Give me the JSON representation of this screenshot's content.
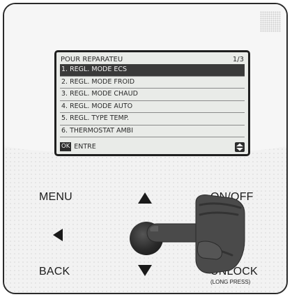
{
  "lcd": {
    "title": "POUR REPARATEU",
    "page": "1/3",
    "items": [
      {
        "label": "1. REGL. MODE ECS",
        "selected": true
      },
      {
        "label": "2. REGL. MODE FROID",
        "selected": false
      },
      {
        "label": "3. REGL. MODE CHAUD",
        "selected": false
      },
      {
        "label": "4. REGL. MODE AUTO",
        "selected": false
      },
      {
        "label": "5. REGL. TYPE TEMP.",
        "selected": false
      },
      {
        "label": "6. THERMOSTAT AMBI",
        "selected": false
      }
    ],
    "ok_badge": "OK",
    "ok_action": "ENTRE"
  },
  "buttons": {
    "menu": "MENU",
    "on_off": "ON/OFF",
    "back": "BACK",
    "unlock": "UNLOCK",
    "unlock_hint": "(LONG PRESS)"
  },
  "icons": {
    "up": "arrow-up-icon",
    "down": "arrow-down-icon",
    "left": "arrow-left-icon",
    "right": "arrow-right-icon",
    "scroll": "scroll-up-down-icon",
    "hand": "pointing-hand-icon"
  }
}
